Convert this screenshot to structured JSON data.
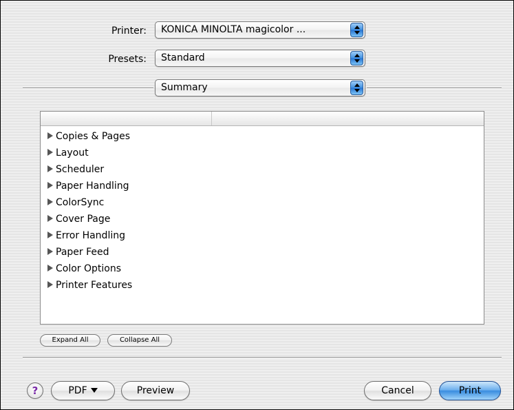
{
  "printer": {
    "label": "Printer:",
    "value": "KONICA MINOLTA magicolor ..."
  },
  "presets": {
    "label": "Presets:",
    "value": "Standard"
  },
  "panel_selector": {
    "value": "Summary"
  },
  "summary_outline": {
    "items": [
      {
        "label": "Copies & Pages"
      },
      {
        "label": "Layout"
      },
      {
        "label": "Scheduler"
      },
      {
        "label": "Paper Handling"
      },
      {
        "label": "ColorSync"
      },
      {
        "label": "Cover Page"
      },
      {
        "label": "Error Handling"
      },
      {
        "label": "Paper Feed"
      },
      {
        "label": "Color Options"
      },
      {
        "label": "Printer Features"
      }
    ]
  },
  "outline_buttons": {
    "expand_all": "Expand All",
    "collapse_all": "Collapse All"
  },
  "footer": {
    "help": "?",
    "pdf": "PDF",
    "preview": "Preview",
    "cancel": "Cancel",
    "print": "Print"
  },
  "colors": {
    "default_button": "#3a8de0",
    "help_glyph": "#7a2aa8"
  },
  "icons": {
    "popup_stepper": "updown-arrows-icon",
    "disclosure": "disclosure-triangle-icon",
    "pdf_menu": "chevron-down-icon"
  }
}
